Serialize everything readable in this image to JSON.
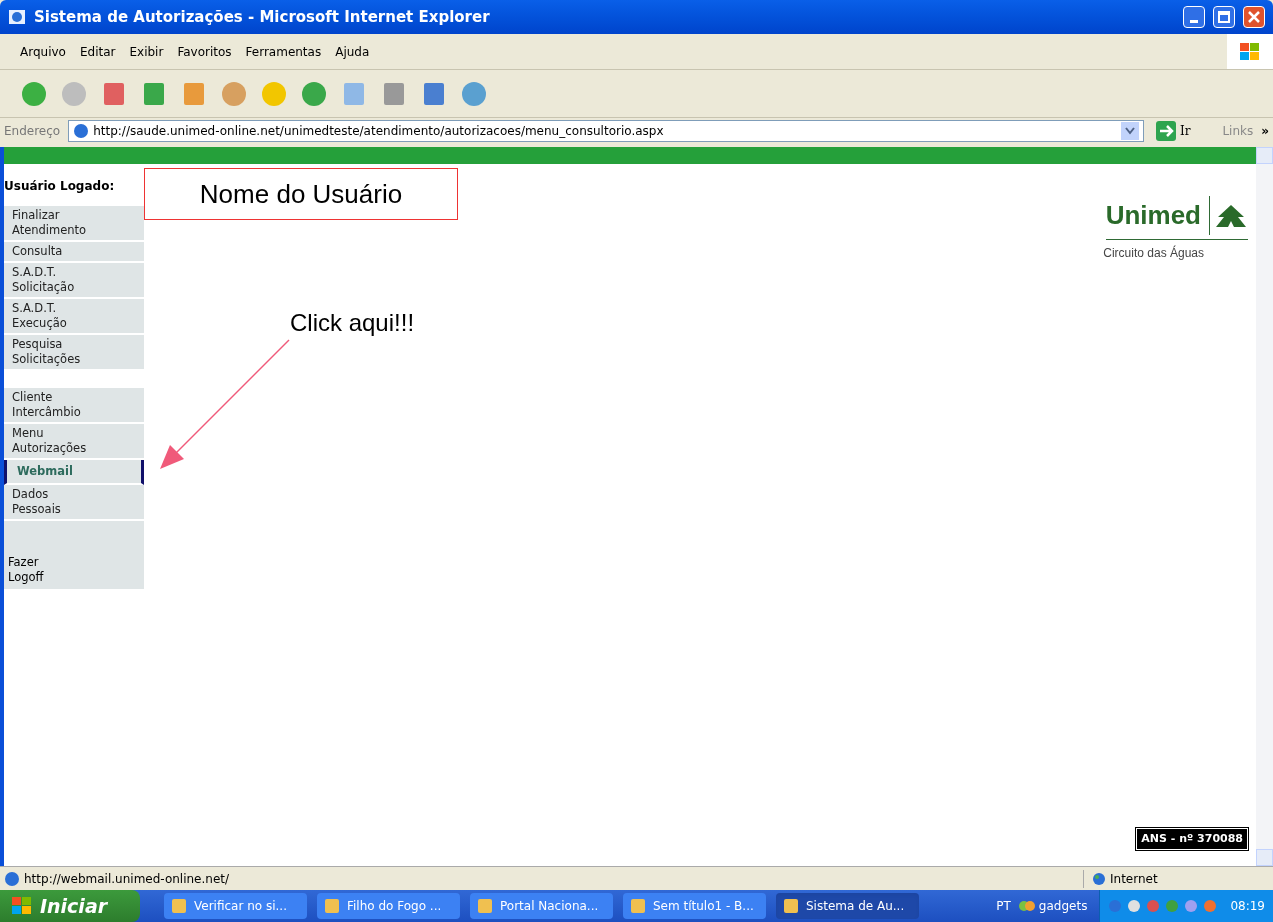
{
  "window": {
    "title": "Sistema de Autorizações - Microsoft Internet Explorer"
  },
  "menu_bar": [
    "Arquivo",
    "Editar",
    "Exibir",
    "Favoritos",
    "Ferramentas",
    "Ajuda"
  ],
  "address_bar": {
    "label": "Endereço",
    "value": "http://saude.unimed-online.net/unimedteste/atendimento/autorizacoes/menu_consultorio.aspx",
    "go": "Ir",
    "links": "Links",
    "more": "»"
  },
  "page": {
    "user_label": "Usuário Logado:",
    "user_name": "Nome do Usuário",
    "sidebar": [
      [
        {
          "label": "Finalizar\nAtendimento",
          "selected": false
        },
        {
          "label": "Consulta",
          "selected": false
        },
        {
          "label": "S.A.D.T.\nSolicitação",
          "selected": false
        },
        {
          "label": "S.A.D.T.\nExecução",
          "selected": false
        },
        {
          "label": "Pesquisa\nSolicitações",
          "selected": false
        }
      ],
      [
        {
          "label": "Cliente\nIntercâmbio",
          "selected": false
        },
        {
          "label": "Menu\nAutorizações",
          "selected": false
        },
        {
          "label": "Webmail",
          "selected": true
        },
        {
          "label": "Dados\nPessoais",
          "selected": false
        }
      ]
    ],
    "logoff": "Fazer\n Logoff",
    "annotation": "Click aqui!!!",
    "logo": {
      "name": "Unimed",
      "subtitle": "Circuito das Águas"
    },
    "ans_badge": "ANS - nº 370088"
  },
  "status_bar": {
    "url": "http://webmail.unimed-online.net/",
    "zone": "Internet"
  },
  "taskbar": {
    "start": "Iniciar",
    "buttons": [
      {
        "label": "Verificar no si...",
        "selected": false
      },
      {
        "label": "Filho do Fogo ...",
        "selected": false
      },
      {
        "label": "Portal Naciona...",
        "selected": false
      },
      {
        "label": "Sem título1 - B...",
        "selected": false
      },
      {
        "label": "Sistema de Au...",
        "selected": true
      }
    ],
    "language": "PT",
    "gadgets": "gadgets",
    "clock": "08:19"
  }
}
